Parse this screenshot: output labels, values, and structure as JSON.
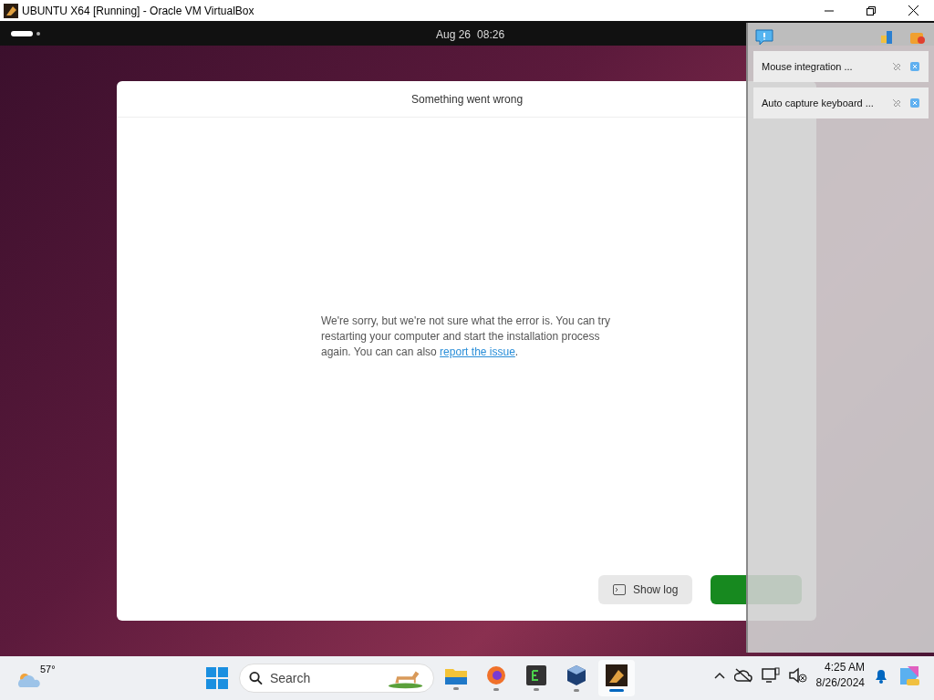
{
  "window": {
    "title": "UBUNTU X64 [Running] - Oracle VM VirtualBox"
  },
  "top_bar": {
    "date": "Aug 26",
    "time": "08:26"
  },
  "dialog": {
    "title": "Something went wrong",
    "message": {
      "text": "We're sorry, but we're not sure what the error is. You can try restarting your computer and start the installation process again. You can can also ",
      "link": "report the issue",
      "end": "."
    },
    "buttons": [
      {
        "kind": "secondary",
        "label": "Show log"
      },
      {
        "kind": "primary"
      }
    ]
  },
  "notifications": [
    "Mouse integration ...",
    "Auto capture keyboard ..."
  ],
  "taskbar": {
    "weather": "57°",
    "search": {
      "placeholder": "Search"
    },
    "apps": [
      {
        "kind": "files",
        "selected": false
      },
      {
        "kind": "browser",
        "selected": false
      },
      {
        "kind": "terminal",
        "selected": false
      },
      {
        "kind": "cube",
        "selected": false
      },
      {
        "kind": "vm",
        "selected": true
      }
    ],
    "clock": {
      "time": "4:25 AM",
      "date": "8/26/2024"
    }
  }
}
